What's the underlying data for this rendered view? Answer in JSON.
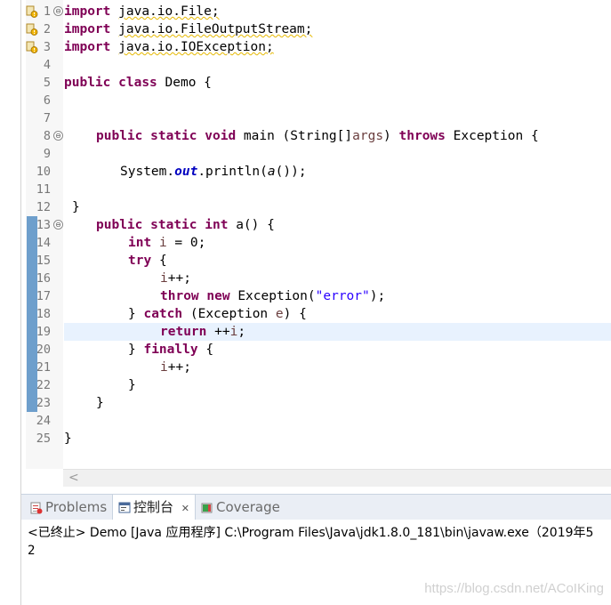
{
  "editor": {
    "line_numbers": [
      "1",
      "2",
      "3",
      "4",
      "5",
      "6",
      "7",
      "8",
      "9",
      "10",
      "11",
      "12",
      "13",
      "14",
      "15",
      "16",
      "17",
      "18",
      "19",
      "20",
      "21",
      "22",
      "23",
      "24",
      "25"
    ],
    "code": {
      "l1_kw": "import",
      "l1_rest": "java.io.File;",
      "l2_kw": "import",
      "l2_rest": "java.io.FileOutputStream;",
      "l3_kw": "import",
      "l3_rest": "java.io.IOException;",
      "l5_kw1": "public",
      "l5_kw2": "class",
      "l5_rest": "Demo {",
      "l8_kw1": "public",
      "l8_kw2": "static",
      "l8_kw3": "void",
      "l8_a": "main (String[]",
      "l8_var": "args",
      "l8_b": ")",
      "l8_kw4": "throws",
      "l8_c": "Exception {",
      "l10_a": "System.",
      "l10_field": "out",
      "l10_b": ".println(",
      "l10_call": "a",
      "l10_c": "());",
      "l12": "}",
      "l13_kw1": "public",
      "l13_kw2": "static",
      "l13_kw3": "int",
      "l13_rest": "a() {",
      "l14_kw": "int",
      "l14_var": "i",
      "l14_rest": "= 0;",
      "l15_kw": "try",
      "l15_rest": "{",
      "l16_var": "i",
      "l16_rest": "++;",
      "l17_kw1": "throw",
      "l17_kw2": "new",
      "l17_a": "Exception(",
      "l17_str": "\"error\"",
      "l17_b": ");",
      "l18_a": "}",
      "l18_kw": "catch",
      "l18_b": "(Exception",
      "l18_var": "e",
      "l18_c": ") {",
      "l19_kw": "return",
      "l19_a": "++",
      "l19_var": "i",
      "l19_b": ";",
      "l20_a": "}",
      "l20_kw": "finally",
      "l20_b": "{",
      "l21_var": "i",
      "l21_rest": "++;",
      "l22": "}",
      "l23": "}",
      "l25": "}"
    },
    "fold_glyph": "⊖",
    "scroll_left_glyph": "<"
  },
  "tabs": {
    "problems": "Problems",
    "console": "控制台",
    "console_close": "✕",
    "coverage": "Coverage"
  },
  "console": {
    "header": "<已终止> Demo [Java 应用程序] C:\\Program Files\\Java\\jdk1.8.0_181\\bin\\javaw.exe（2019年5",
    "output": "2"
  },
  "watermark": "https://blog.csdn.net/ACoIKing",
  "colors": {
    "keyword": "#7f0055",
    "string": "#2a00ff",
    "field": "#0000c0",
    "local_var": "#6a3e3e",
    "current_line": "#e8f2fe",
    "range_indicator": "#6e9fcc"
  }
}
